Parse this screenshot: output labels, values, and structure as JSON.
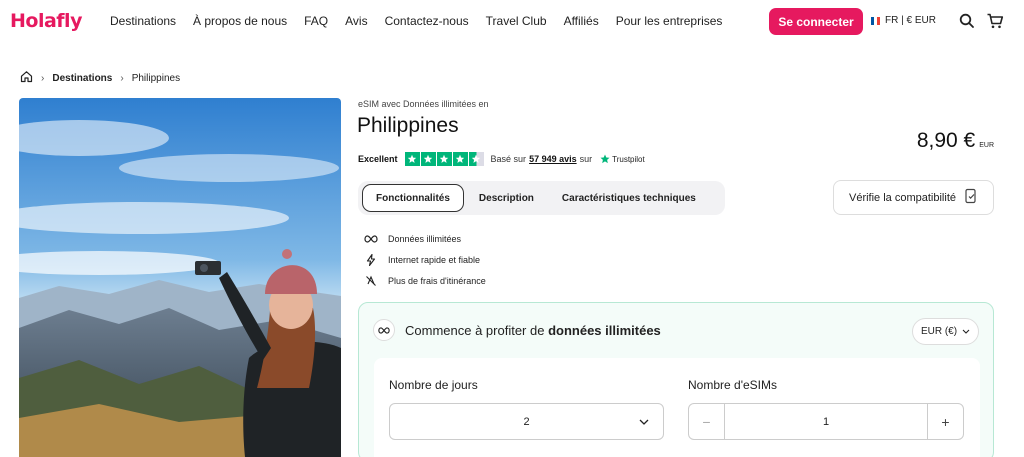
{
  "brand": {
    "logo": "Holafly",
    "accent": "#e6195f"
  },
  "nav": {
    "items": [
      "Destinations",
      "À propos de nous",
      "FAQ",
      "Avis",
      "Contactez-nous",
      "Travel Club",
      "Affiliés",
      "Pour les entreprises"
    ],
    "login_label": "Se connecter",
    "lang_label": "FR | € EUR",
    "icons": [
      "search-icon",
      "cart-icon"
    ]
  },
  "breadcrumb": [
    "Destinations",
    "Philippines"
  ],
  "product": {
    "subtitle": "eSIM avec Données illimitées en",
    "title": "Philippines",
    "price": "8,90 €",
    "price_currency": "EUR",
    "rating_label": "Excellent",
    "rating_stars": 4.5,
    "based_on": "Basé sur",
    "review_count": "57 949 avis",
    "on": "sur",
    "trustpilot": "Trustpilot"
  },
  "tabs": [
    "Fonctionnalités",
    "Description",
    "Caractéristiques techniques"
  ],
  "active_tab": "Fonctionnalités",
  "compat_label": "Vérifie la compatibilité",
  "features": [
    {
      "icon": "infinity-icon",
      "label": "Données illimitées"
    },
    {
      "icon": "lightning-icon",
      "label": "Internet rapide et fiable"
    },
    {
      "icon": "no-roaming-icon",
      "label": "Plus de frais d'itinérance"
    }
  ],
  "plan": {
    "heading_prefix": "Commence à profiter de",
    "heading_bold": "données illimitées",
    "currency": "EUR (€)",
    "days_label": "Nombre de jours",
    "days_value": "2",
    "esims_label": "Nombre d'eSIMs",
    "esims_value": "1",
    "minus": "−",
    "plus": "+"
  }
}
